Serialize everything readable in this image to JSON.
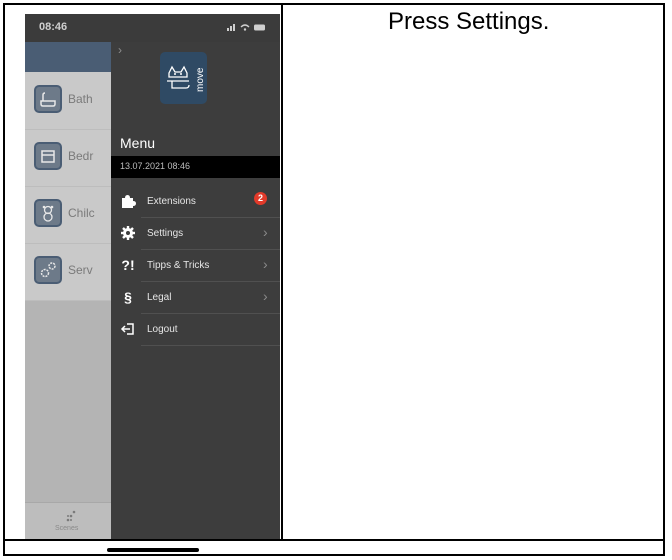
{
  "instruction": "Press Settings.",
  "status_bar": {
    "time": "08:46",
    "icons": "signal-wifi-battery"
  },
  "background_list": {
    "items": [
      {
        "label": "Bath",
        "icon": "bathtub-icon"
      },
      {
        "label": "Bedr",
        "icon": "bed-icon"
      },
      {
        "label": "Chilc",
        "icon": "teddy-bear-icon"
      },
      {
        "label": "Serv",
        "icon": "gears-icon"
      }
    ],
    "bottom_tab": {
      "label": "Scenes",
      "icon": "scenes-icon"
    }
  },
  "drawer": {
    "title": "Menu",
    "timestamp": "13.07.2021 08:46",
    "logo_text": "move",
    "items": [
      {
        "label": "Extensions",
        "icon": "puzzle-icon",
        "badge": "2"
      },
      {
        "label": "Settings",
        "icon": "gear-icon"
      },
      {
        "label": "Tipps & Tricks",
        "icon": "question-exclamation-icon",
        "glyph": "?!"
      },
      {
        "label": "Legal",
        "icon": "section-sign-icon",
        "glyph": "§"
      },
      {
        "label": "Logout",
        "icon": "logout-icon"
      }
    ]
  },
  "colors": {
    "drawer_bg": "#3d3d3d",
    "brand_blue": "#2f4a64",
    "badge_red": "#e23a2a"
  }
}
